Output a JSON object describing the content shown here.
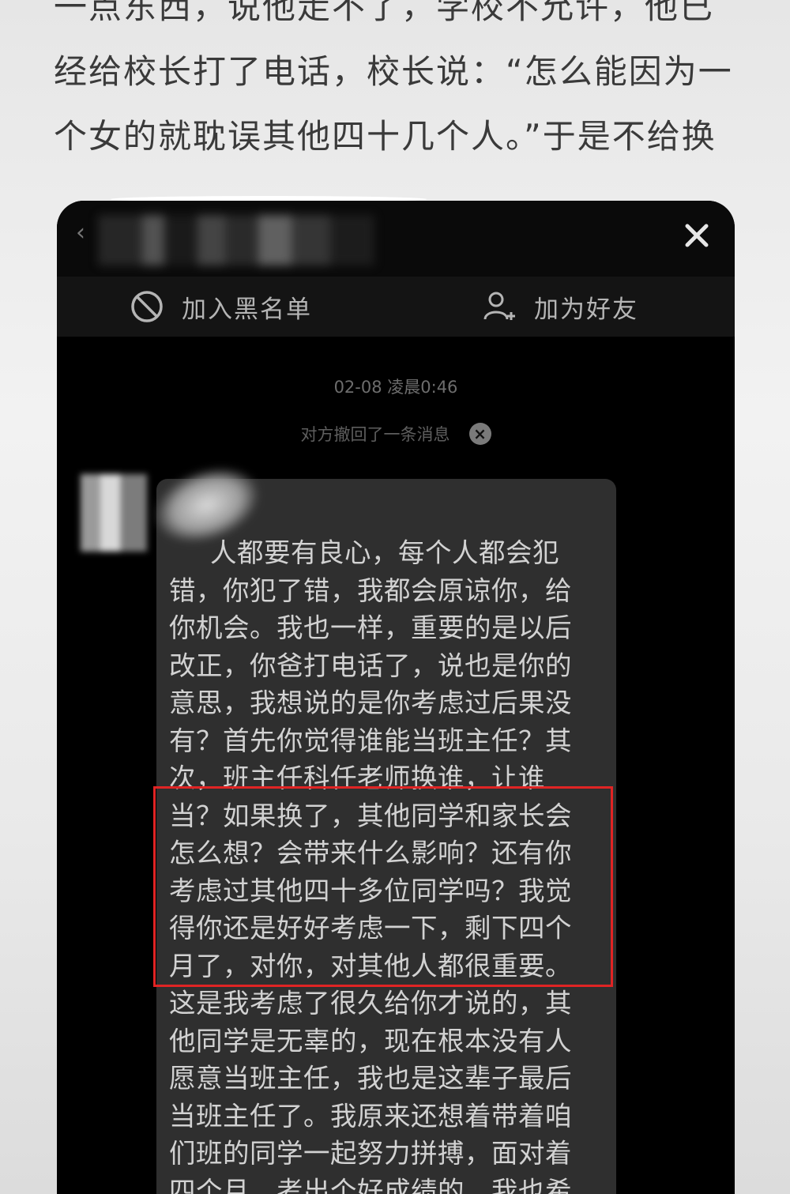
{
  "article": {
    "lines": [
      "一点东西，说他走不了，学校不允许，他已",
      "经给校长打了电话，校长说：“怎么能因为一",
      "个女的就耽误其他四十几个人。”于是不给换"
    ]
  },
  "chat": {
    "actions": {
      "block_label": "加入黑名单",
      "add_friend_label": "加为好友"
    },
    "timestamp": "02-08 凌晨0:46",
    "recall_notice": "对方撤回了一条消息",
    "message_lines": [
      "人都要有良心，每个人都会犯",
      "错，你犯了错，我都会原谅你，给",
      "你机会。我也一样，重要的是以后",
      "改正，你爸打电话了，说也是你的",
      "意思，我想说的是你考虑过后果没",
      "有？首先你觉得谁能当班主任？其",
      "次，班主任科任老师换谁，让谁",
      "当？如果换了，其他同学和家长会",
      "怎么想？会带来什么影响？还有你",
      "考虑过其他四十多位同学吗？我觉",
      "得你还是好好考虑一下，剩下四个",
      "月了，对你，对其他人都很重要。",
      "这是我考虑了很久给你才说的，其",
      "他同学是无辜的，现在根本没有人",
      "愿意当班主任，我也是这辈子最后",
      "当班主任了。我原来还想着带着咱",
      "们班的同学一起努力拼搏，面对着",
      "四个月，考出个好成绩的，我也希"
    ]
  },
  "colors": {
    "highlight_border": "#e02424",
    "bubble_bg": "#2f2f2f",
    "screen_bg": "#000000"
  },
  "icons": [
    "back-arrow-icon",
    "close-icon",
    "block-icon",
    "add-friend-icon",
    "recall-close-icon"
  ]
}
